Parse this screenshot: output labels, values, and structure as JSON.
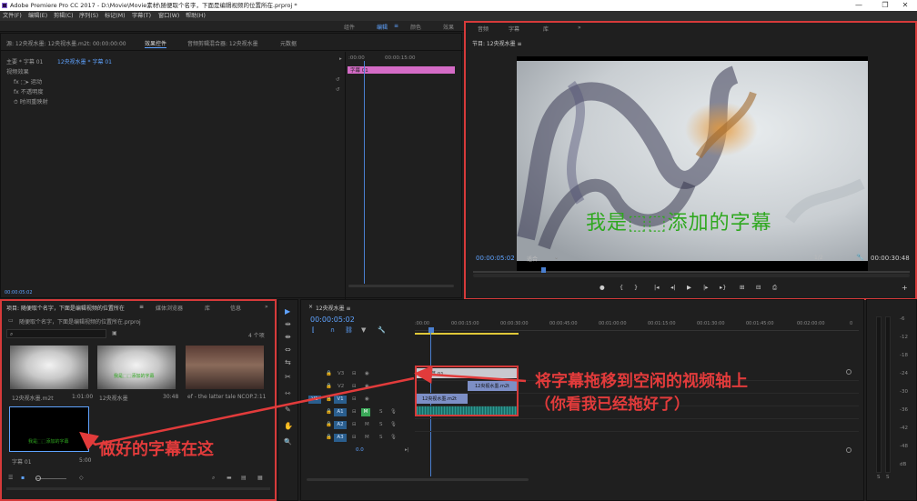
{
  "window": {
    "title": "Adobe Premiere Pro CC 2017 - D:\\Movie\\Movie素材\\随便取个名字，下面是编辑视频的位置所在.prproj *",
    "controls": [
      "—",
      "❐",
      "✕"
    ]
  },
  "menu": [
    "文件(F)",
    "编辑(E)",
    "剪辑(C)",
    "序列(S)",
    "标记(M)",
    "字幕(T)",
    "窗口(W)",
    "帮助(H)"
  ],
  "workspaces": [
    "组件",
    "编辑",
    "颜色",
    "效果"
  ],
  "source_panel": {
    "tabs": [
      "源: 12央视水墨: 12央视水墨.m2t: 00:00:00:00",
      "效果控件",
      "音频剪辑混合器: 12央视水墨",
      "元数据"
    ],
    "crumb": "主要 * 字幕 01",
    "crumb_active": "12央视水墨 * 字幕 01",
    "section": "视频效果",
    "rows": [
      "fx ⬚▸ 运动",
      "fx 不透明度",
      "⏱ 时间重映射"
    ],
    "clip_label": "字幕 01",
    "time_a": ":00:00",
    "time_b": "00:00:15:00",
    "timecode": "00:00:05:02"
  },
  "program_panel": {
    "tabs": [
      "音频",
      "字幕",
      "库",
      "»"
    ],
    "title": "节目: 12央视水墨 ≡",
    "subtitle": "我是⬚⬚添加的字幕",
    "timecode": "00:00:05:02",
    "fit": "适合",
    "res": "1/2",
    "duration": "00:00:30:48",
    "transport": [
      "●",
      "{",
      "}",
      "|◂",
      "◂|",
      "▶",
      "|▸",
      "▸}",
      "⊞",
      "⊟",
      "⎙"
    ]
  },
  "project_panel": {
    "tabs": [
      "项目: 随便取个名字，下面是编辑视频的位置所在",
      "媒体浏览器",
      "库",
      "信息",
      "»"
    ],
    "path": "随便取个名字，下面是编辑视频的位置所在.prproj",
    "item_count": "4 个项",
    "items": [
      {
        "name": "12央视水墨.m2t",
        "dur": "1:01:00"
      },
      {
        "name": "12央视水墨",
        "dur": "30:48",
        "caption": "我是⬚⬚添加的字幕"
      },
      {
        "name": "ef - the latter tale NCOP...",
        "dur": "7:11"
      },
      {
        "name": "字幕 01",
        "dur": "5:00",
        "caption": "我是⬚⬚添加的字幕"
      }
    ]
  },
  "tools": [
    "▶",
    "⇹",
    "⇼",
    "⇔",
    "⇆",
    "✂",
    "⇿",
    "✎",
    "✋",
    "🔍"
  ],
  "timeline": {
    "tab": "12央视水墨 ≡",
    "timecode": "00:00:05:02",
    "ruler": [
      ":00:00",
      "00:00:15:00",
      "00:00:30:00",
      "00:00:45:00",
      "00:01:00:00",
      "00:01:15:00",
      "00:01:30:00",
      "00:01:45:00",
      "00:02:00:00",
      "0"
    ],
    "tracks": [
      "V3",
      "V2",
      "V1",
      "A1",
      "A2",
      "A3"
    ],
    "src_v": "V1",
    "clip_title": "字幕 01",
    "clip_v2": "12央视水墨.m2t",
    "clip_v1": "12央视水墨.m2t",
    "vol": "0.0",
    "audio_labels": [
      "M",
      "S"
    ]
  },
  "meter": {
    "scale": [
      "-6",
      "-12",
      "-18",
      "-24",
      "-30",
      "-36",
      "-42",
      "-48",
      "dB"
    ],
    "solo": [
      "S",
      "S"
    ]
  },
  "annotations": {
    "drag_line1": "将字幕拖移到空闲的视频轴上",
    "drag_line2": "（你看我已经拖好了）",
    "done": "做好的字幕在这"
  },
  "colors": {
    "accent": "#5fa3ff",
    "highlight": "#d63a3a",
    "subtitle": "#2fa81f",
    "clip_pink": "#d46bc6"
  }
}
